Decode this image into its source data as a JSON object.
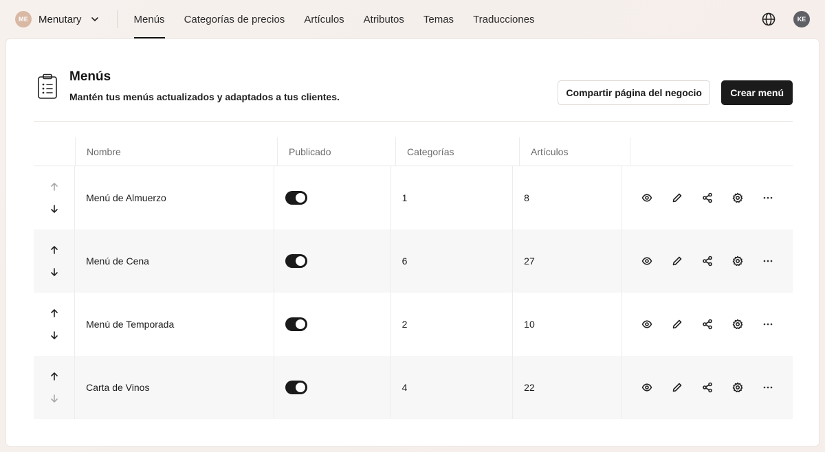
{
  "brand": {
    "initials": "ME",
    "name": "Menutary"
  },
  "nav": {
    "items": [
      {
        "label": "Menús",
        "active": true
      },
      {
        "label": "Categorías de precios",
        "active": false
      },
      {
        "label": "Artículos",
        "active": false
      },
      {
        "label": "Atributos",
        "active": false
      },
      {
        "label": "Temas",
        "active": false
      },
      {
        "label": "Traducciones",
        "active": false
      }
    ]
  },
  "user": {
    "initials": "KE"
  },
  "page": {
    "title": "Menús",
    "subtitle": "Mantén tus menús actualizados y adaptados a tus clientes.",
    "share_button": "Compartir página del negocio",
    "create_button": "Crear menú"
  },
  "table": {
    "columns": [
      "Nombre",
      "Publicado",
      "Categorías",
      "Artículos"
    ],
    "rows": [
      {
        "name": "Menú de Almuerzo",
        "published": true,
        "categories": "1",
        "articles": "8"
      },
      {
        "name": "Menú de Cena",
        "published": true,
        "categories": "6",
        "articles": "27"
      },
      {
        "name": "Menú de Temporada",
        "published": true,
        "categories": "2",
        "articles": "10"
      },
      {
        "name": "Carta de Vinos",
        "published": true,
        "categories": "4",
        "articles": "22"
      }
    ]
  },
  "icons": {
    "row_actions": [
      "eye-icon",
      "pencil-icon",
      "share-icon",
      "settings-icon",
      "more-icon"
    ],
    "header": "clipboard-list-icon"
  },
  "colors": {
    "accent": "#1b1b1b",
    "background": "#f6f0ed",
    "alt_row": "#f7f7f7"
  }
}
